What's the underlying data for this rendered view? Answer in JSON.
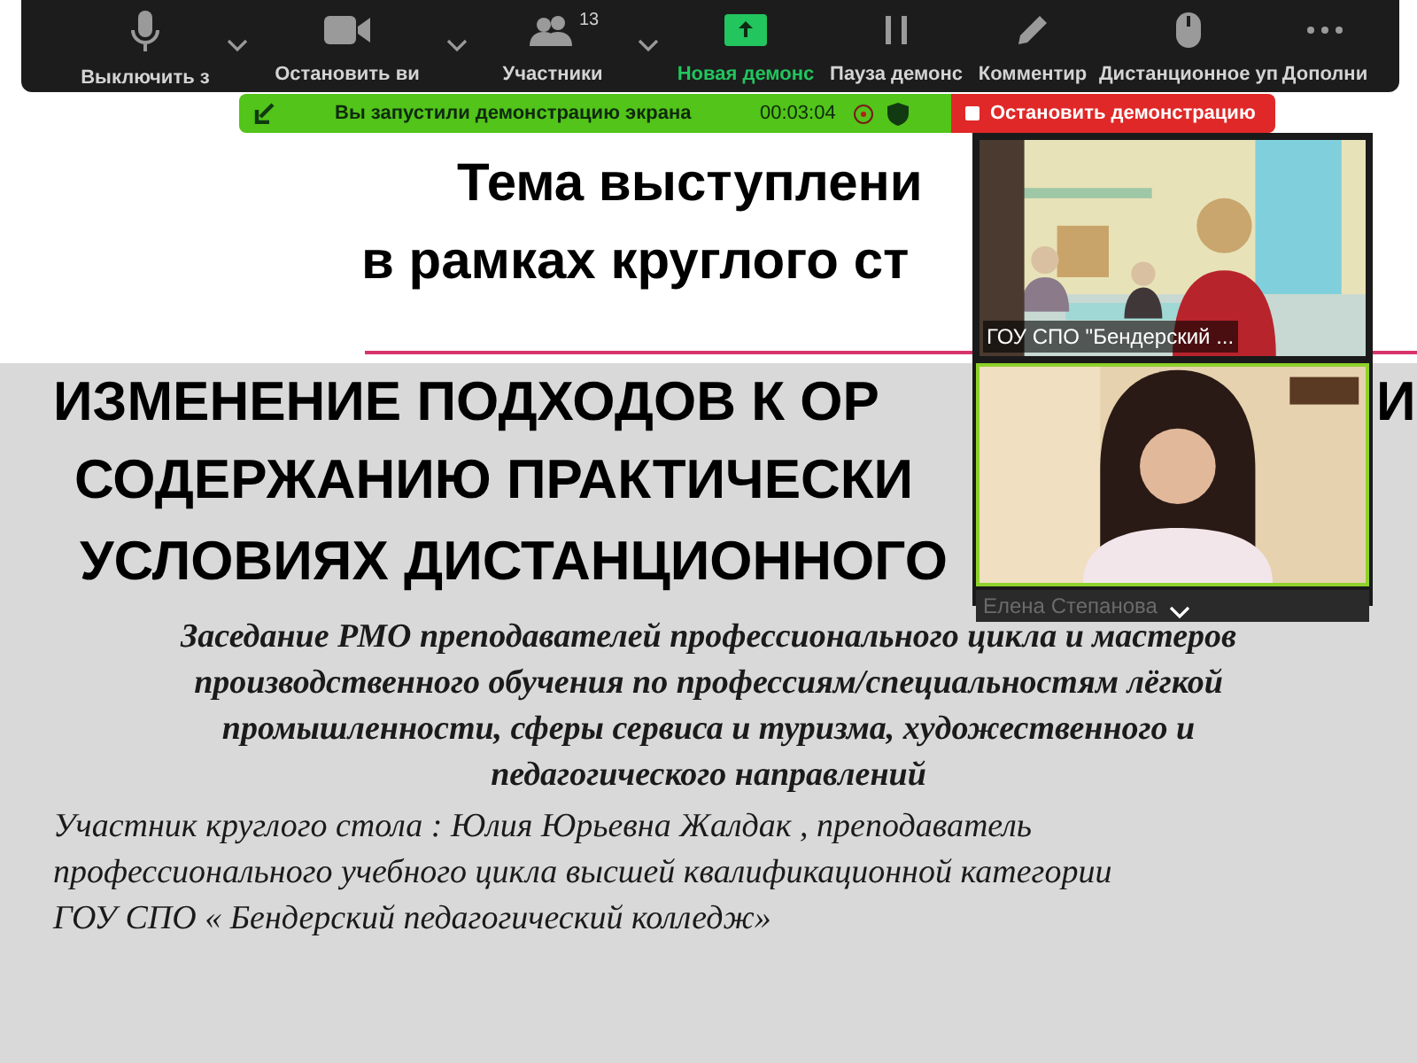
{
  "toolbar": {
    "buttons": [
      {
        "kind": "mic",
        "label": "Выключить з",
        "menu": true
      },
      {
        "kind": "video",
        "label": "Остановить ви",
        "menu": true
      },
      {
        "kind": "participants",
        "label": "Участники",
        "count": "13",
        "menu": true
      },
      {
        "kind": "share",
        "label": "Новая демонс",
        "menu": false
      },
      {
        "kind": "pause",
        "label": "Пауза демонс",
        "menu": false
      },
      {
        "kind": "annotate",
        "label": "Комментир",
        "menu": false
      },
      {
        "kind": "remote",
        "label": "Дистанционное уп",
        "menu": false
      },
      {
        "kind": "more",
        "label": "Дополни",
        "menu": false
      }
    ]
  },
  "share_bar": {
    "message": "Вы запустили демонстрацию экрана",
    "timer": "00:03:04",
    "stop_button": "Остановить демонстрацию"
  },
  "slide": {
    "title_lines": [
      "Тема выступлени",
      "в рамках круглого ст"
    ],
    "heading_lines": [
      "ИЗМЕНЕНИЕ ПОДХОДОВ К ОР",
      "СОДЕРЖАНИЮ ПРАКТИЧЕСКИ",
      "УСЛОВИЯХ ДИСТАНЦИОННОГО"
    ],
    "heading_fragment": "И",
    "subtitle_lines": [
      "Заседание РМО преподавателей профессионального цикла и  мастеров",
      "производственного обучения по профессиям/специальностям лёгкой",
      "промышленности, сферы сервиса и туризма, художественного и",
      "педагогического направлений"
    ],
    "participant_lines": [
      "Участник круглого стола  : Юлия Юрьевна Жалдак  , преподаватель",
      "профессионального учебного цикла высшей квалификационной категории",
      "ГОУ СПО « Бендерский педагогический колледж»"
    ]
  },
  "video_panel": {
    "tiles": [
      {
        "kind": "picture",
        "name": "ГОУ СПО \"Бендерский ...",
        "active": false
      },
      {
        "kind": "picture",
        "name": "Елена Степанова",
        "active": true
      }
    ]
  }
}
